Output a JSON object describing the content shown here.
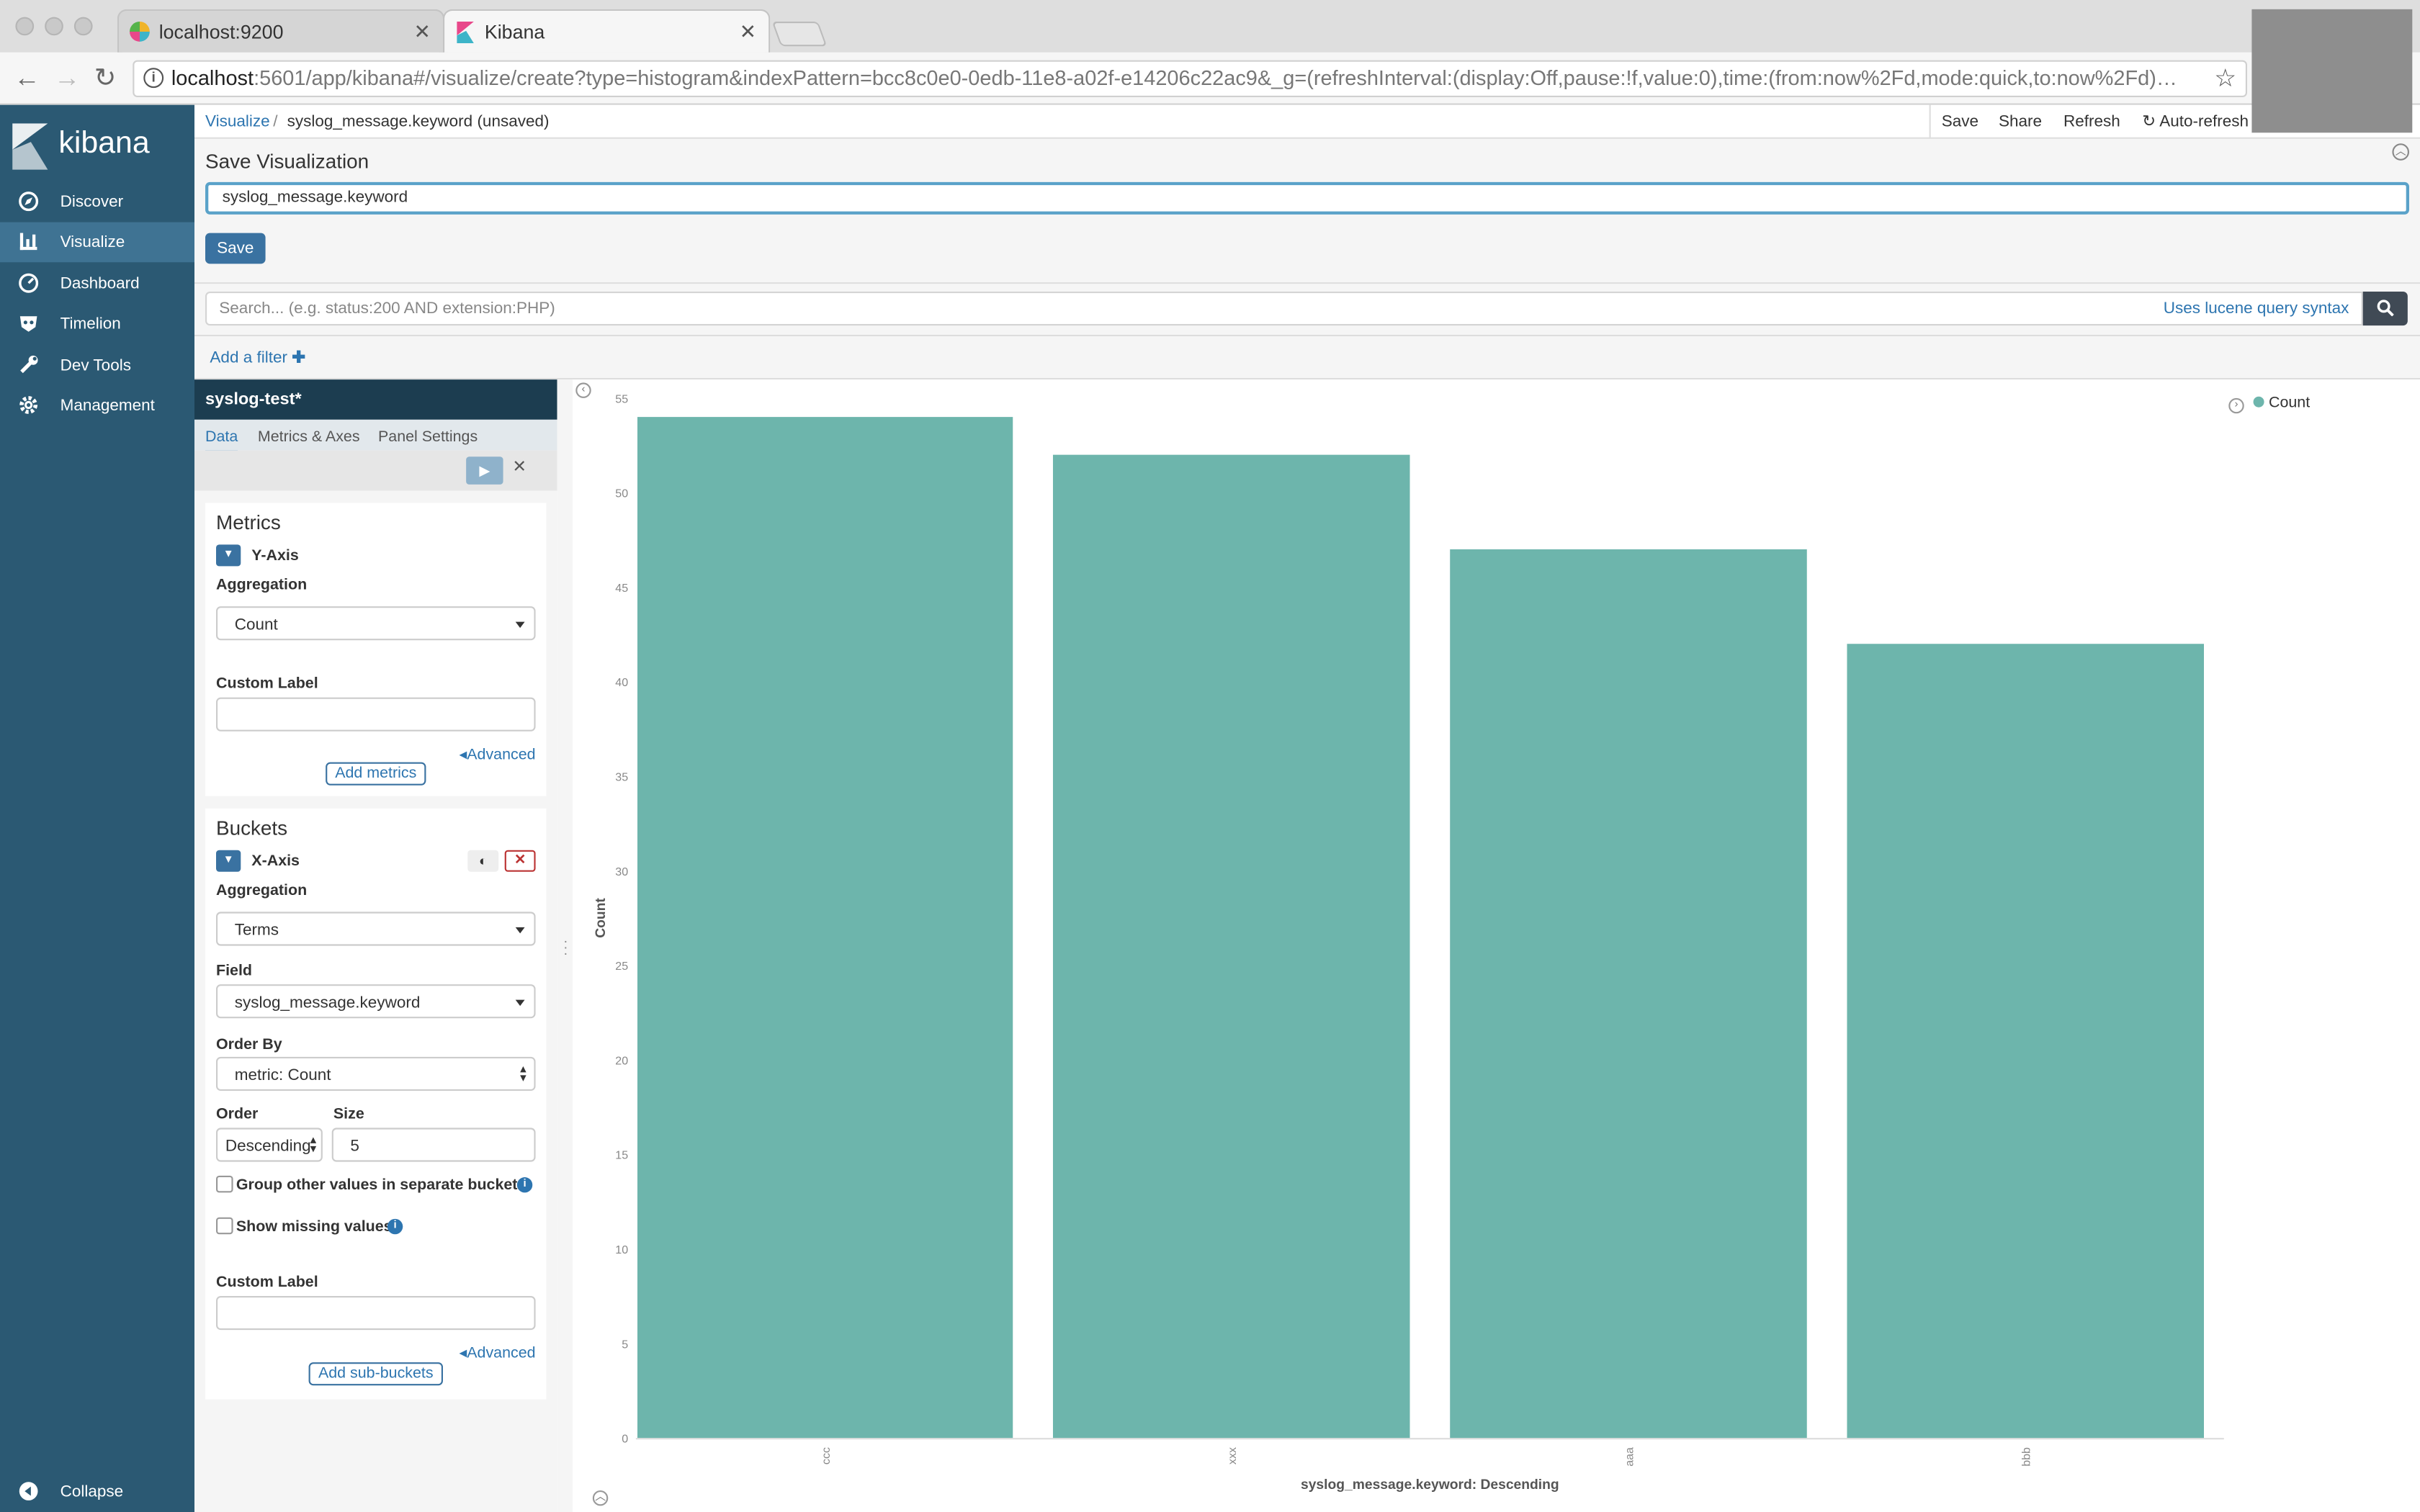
{
  "browser": {
    "tabs": [
      {
        "label": "localhost:9200",
        "active": false
      },
      {
        "label": "Kibana",
        "active": true
      }
    ],
    "url_host": "localhost",
    "url_rest": ":5601/app/kibana#/visualize/create?type=histogram&indexPattern=bcc8c0e0-0edb-11e8-a02f-e14206c22ac9&_g=(refreshInterval:(display:Off,pause:!f,value:0),time:(from:now%2Fd,mode:quick,to:now%2Fd)…"
  },
  "sidebar": {
    "brand": "kibana",
    "items": [
      {
        "label": "Discover",
        "icon": "compass-icon"
      },
      {
        "label": "Visualize",
        "icon": "bar-chart-icon",
        "active": true
      },
      {
        "label": "Dashboard",
        "icon": "dashboard-icon"
      },
      {
        "label": "Timelion",
        "icon": "timelion-icon"
      },
      {
        "label": "Dev Tools",
        "icon": "wrench-icon"
      },
      {
        "label": "Management",
        "icon": "gear-icon"
      }
    ],
    "collapse": "Collapse"
  },
  "breadcrumb": {
    "root": "Visualize",
    "sep": "/",
    "current": "syslog_message.keyword (unsaved)"
  },
  "topmenu": {
    "save": "Save",
    "share": "Share",
    "refresh": "Refresh",
    "autorefresh": "Auto-refresh"
  },
  "save_panel": {
    "title": "Save Visualization",
    "input_value": "syslog_message.keyword",
    "button": "Save"
  },
  "query": {
    "placeholder": "Search... (e.g. status:200 AND extension:PHP)",
    "syntax_link": "Uses lucene query syntax"
  },
  "filter": {
    "add": "Add a filter"
  },
  "editor": {
    "index_pattern": "syslog-test*",
    "tabs": [
      "Data",
      "Metrics & Axes",
      "Panel Settings"
    ],
    "metrics": {
      "title": "Metrics",
      "axis": "Y-Axis",
      "aggregation_label": "Aggregation",
      "aggregation": "Count",
      "custom_label": "Custom Label",
      "advanced": "Advanced",
      "add_button": "Add metrics"
    },
    "buckets": {
      "title": "Buckets",
      "axis": "X-Axis",
      "aggregation_label": "Aggregation",
      "aggregation": "Terms",
      "field_label": "Field",
      "field": "syslog_message.keyword",
      "order_by_label": "Order By",
      "order_by": "metric: Count",
      "order_label": "Order",
      "order": "Descending",
      "size_label": "Size",
      "size": "5",
      "group_other": "Group other values in separate bucket",
      "show_missing": "Show missing values",
      "custom_label": "Custom Label",
      "advanced": "Advanced",
      "add_button": "Add sub-buckets"
    }
  },
  "colors": {
    "bar": "#6db5ac",
    "sidebar": "#2b5973",
    "accent": "#2d75b0"
  },
  "chart_data": {
    "type": "bar",
    "categories": [
      "ccc",
      "xxx",
      "aaa",
      "bbb"
    ],
    "series": [
      {
        "name": "Count",
        "values": [
          54,
          52,
          47,
          42
        ]
      }
    ],
    "xlabel": "syslog_message.keyword: Descending",
    "ylabel": "Count",
    "ylim": [
      0,
      55
    ],
    "yticks": [
      0,
      5,
      10,
      15,
      20,
      25,
      30,
      35,
      40,
      45,
      50,
      55
    ],
    "legend": "top-right",
    "legend_label": "Count"
  }
}
